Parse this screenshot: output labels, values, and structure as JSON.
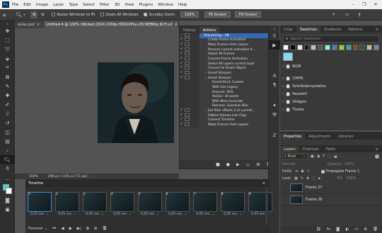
{
  "menubar": {
    "logo": "Ps",
    "items": [
      "File",
      "Edit",
      "Image",
      "Layer",
      "Type",
      "Select",
      "Filter",
      "3D",
      "View",
      "Plugins",
      "Window",
      "Help"
    ],
    "minimize": "–",
    "restore": "❐",
    "close": "✕"
  },
  "options_bar": {
    "resize_windows": "Resize Windows to Fit",
    "zoom_all": "Zoom All Windows",
    "scrubby_zoom": "Scrubby Zoom",
    "zoom_value": "100%",
    "fit_screen": "Fit Screen",
    "fill_screen": "Fill Screen"
  },
  "doc_tabs": {
    "tab1": "eulas.psd",
    "tab2": "Untitled-4 @ 100% (Wicked.2024.2160p.HDR10Plus.DV.WEBRip.6CH.x2",
    "close": "×"
  },
  "status": {
    "zoom": "100%",
    "size": "268 px x 226 px (72 ppi)"
  },
  "actions_panel": {
    "tab_history": "History",
    "tab_actions": "Actions",
    "rows": [
      {
        "label": "Sharpening - HD",
        "check": "✓",
        "twirl": "⌄",
        "hl": true
      },
      {
        "label": "Create Frame Animation",
        "check": "✓"
      },
      {
        "label": "Make Frames From Layers",
        "check": "✓"
      },
      {
        "label": "Reverse current animation fr...",
        "check": "✓"
      },
      {
        "label": "Select All Frames",
        "check": "✓"
      },
      {
        "label": "Convert Frame Animation",
        "check": "✓"
      },
      {
        "label": "Select All Layers current layer",
        "check": "✓"
      },
      {
        "label": "Convert to Smart Object",
        "check": "✓"
      },
      {
        "label": "Smart Sharpen",
        "check": "✓",
        "twirl": "›"
      },
      {
        "label": "Smart Sharpen",
        "check": "✓",
        "twirl": "⌄"
      },
      {
        "label": "Preset Kind: Custom",
        "check": ""
      },
      {
        "label": "With Use Legacy",
        "check": ""
      },
      {
        "label": "Amount: 30%",
        "check": ""
      },
      {
        "label": "Radius: 30 pixels",
        "check": ""
      },
      {
        "label": "With More Accurate",
        "check": ""
      },
      {
        "label": "Remove: Gaussian Blur",
        "check": ""
      },
      {
        "label": "Set filter effects 2 of current...",
        "check": "✓",
        "twirl": "›"
      },
      {
        "label": "Flatten Frames Into Clips",
        "check": "✓"
      },
      {
        "label": "Convert Timeline",
        "check": "✓"
      },
      {
        "label": "Make Frames From Layers",
        "check": "✓"
      }
    ],
    "menu": "≡"
  },
  "swatches_panel": {
    "tabs": [
      "Color",
      "Swatches",
      "Gradients",
      "Patterns"
    ],
    "search_placeholder": "Search Swatches",
    "swatch_colors": [
      "#ffffff",
      "#000000",
      "#e8e8e8",
      "#1a1a1a",
      "#c0c0c0",
      "#5a5a5a",
      "#7fffd4",
      "#4682b4",
      "#9acd32",
      "#3aa0a0",
      "#8b4513",
      "#2f4f4f",
      "#d2b48c",
      "#778899"
    ],
    "current": "#87d8f0",
    "groups": [
      "RGB",
      "CMYK",
      "Szürkeárnyalatos",
      "Pasztell",
      "Világos",
      "Tiszta"
    ]
  },
  "layers_panel": {
    "tabs": [
      "Properties",
      "Adjustments",
      "Libraries"
    ],
    "subtabs": [
      "Layers",
      "Channels",
      "Paths"
    ],
    "kind": "Kind",
    "mode": "Normal",
    "opacity_label": "Opacity:",
    "opacity_value": "100%",
    "unify_label": "Unify:",
    "propagate_label": "Propagate Frame 1",
    "lock_label": "Lock:",
    "fill_label": "Fill:",
    "fill_value": "100%",
    "layers": [
      "Frame 27",
      "Frame 26"
    ]
  },
  "timeline": {
    "title": "Timeline",
    "frames": [
      {
        "num": "1",
        "time": "0,05 sec.",
        "sel": true
      },
      {
        "num": "2",
        "time": "0,05 sec."
      },
      {
        "num": "3",
        "time": "0,05 sec."
      },
      {
        "num": "4",
        "time": "0,05 sec."
      },
      {
        "num": "5",
        "time": "0,05 sec."
      },
      {
        "num": "6",
        "time": "0,05 sec."
      },
      {
        "num": "7",
        "time": "0,05 sec."
      },
      {
        "num": "8",
        "time": "0,05 sec."
      },
      {
        "num": "9",
        "time": "0,05 sec."
      }
    ],
    "loop": "Forever"
  }
}
